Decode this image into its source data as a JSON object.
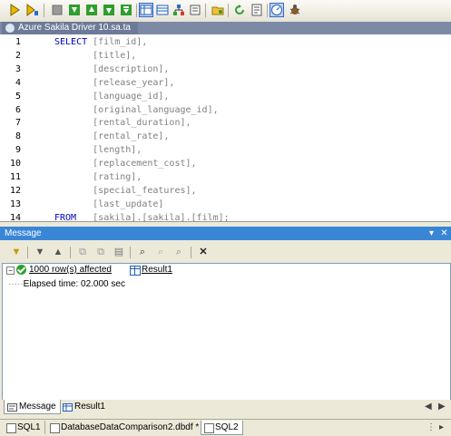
{
  "toolbar": {
    "icons": [
      "execute-icon",
      "execute-step-icon",
      "stop-icon",
      "result-first-icon",
      "result-prev-icon",
      "result-next-icon",
      "result-last-icon",
      "result-grid-icon",
      "result-tabbed-icon",
      "tree-icon",
      "open-folder-icon",
      "refresh-icon",
      "properties-icon",
      "gauge-icon",
      "debug-icon"
    ],
    "active": [
      "result-grid-icon",
      "gauge-icon"
    ]
  },
  "document": {
    "tab_label": "Azure Sakila Driver 10.sa.ta"
  },
  "editor": {
    "line_numbers": [
      "1",
      "2",
      "3",
      "4",
      "5",
      "6",
      "7",
      "8",
      "9",
      "10",
      "11",
      "12",
      "13",
      "14"
    ],
    "lines": [
      {
        "kw": "SELECT",
        "text": " [film_id],"
      },
      {
        "kw": "",
        "text": "       [title],"
      },
      {
        "kw": "",
        "text": "       [description],"
      },
      {
        "kw": "",
        "text": "       [release_year],"
      },
      {
        "kw": "",
        "text": "       [language_id],"
      },
      {
        "kw": "",
        "text": "       [original_language_id],"
      },
      {
        "kw": "",
        "text": "       [rental_duration],"
      },
      {
        "kw": "",
        "text": "       [rental_rate],"
      },
      {
        "kw": "",
        "text": "       [length],"
      },
      {
        "kw": "",
        "text": "       [replacement_cost],"
      },
      {
        "kw": "",
        "text": "       [rating],"
      },
      {
        "kw": "",
        "text": "       [special_features],"
      },
      {
        "kw": "",
        "text": "       [last_update]"
      },
      {
        "kw": "FROM",
        "text": "   [sakila].[sakila].[film];"
      }
    ]
  },
  "message_panel": {
    "title": "Message",
    "result_link": "1000 row(s) affected",
    "result_tab_link": "Result1",
    "elapsed_prefix": "·····",
    "elapsed": "Elapsed time: 02.000 sec"
  },
  "bottom_tabs": [
    {
      "label": "Message",
      "icon": "message-icon",
      "active": true
    },
    {
      "label": "Result1",
      "icon": "grid-icon",
      "active": false
    }
  ],
  "doc_tabs": [
    {
      "label": "SQL1",
      "active": false
    },
    {
      "label": "DatabaseDataComparison2.dbdf *",
      "active": false
    },
    {
      "label": "SQL2",
      "active": true
    }
  ]
}
